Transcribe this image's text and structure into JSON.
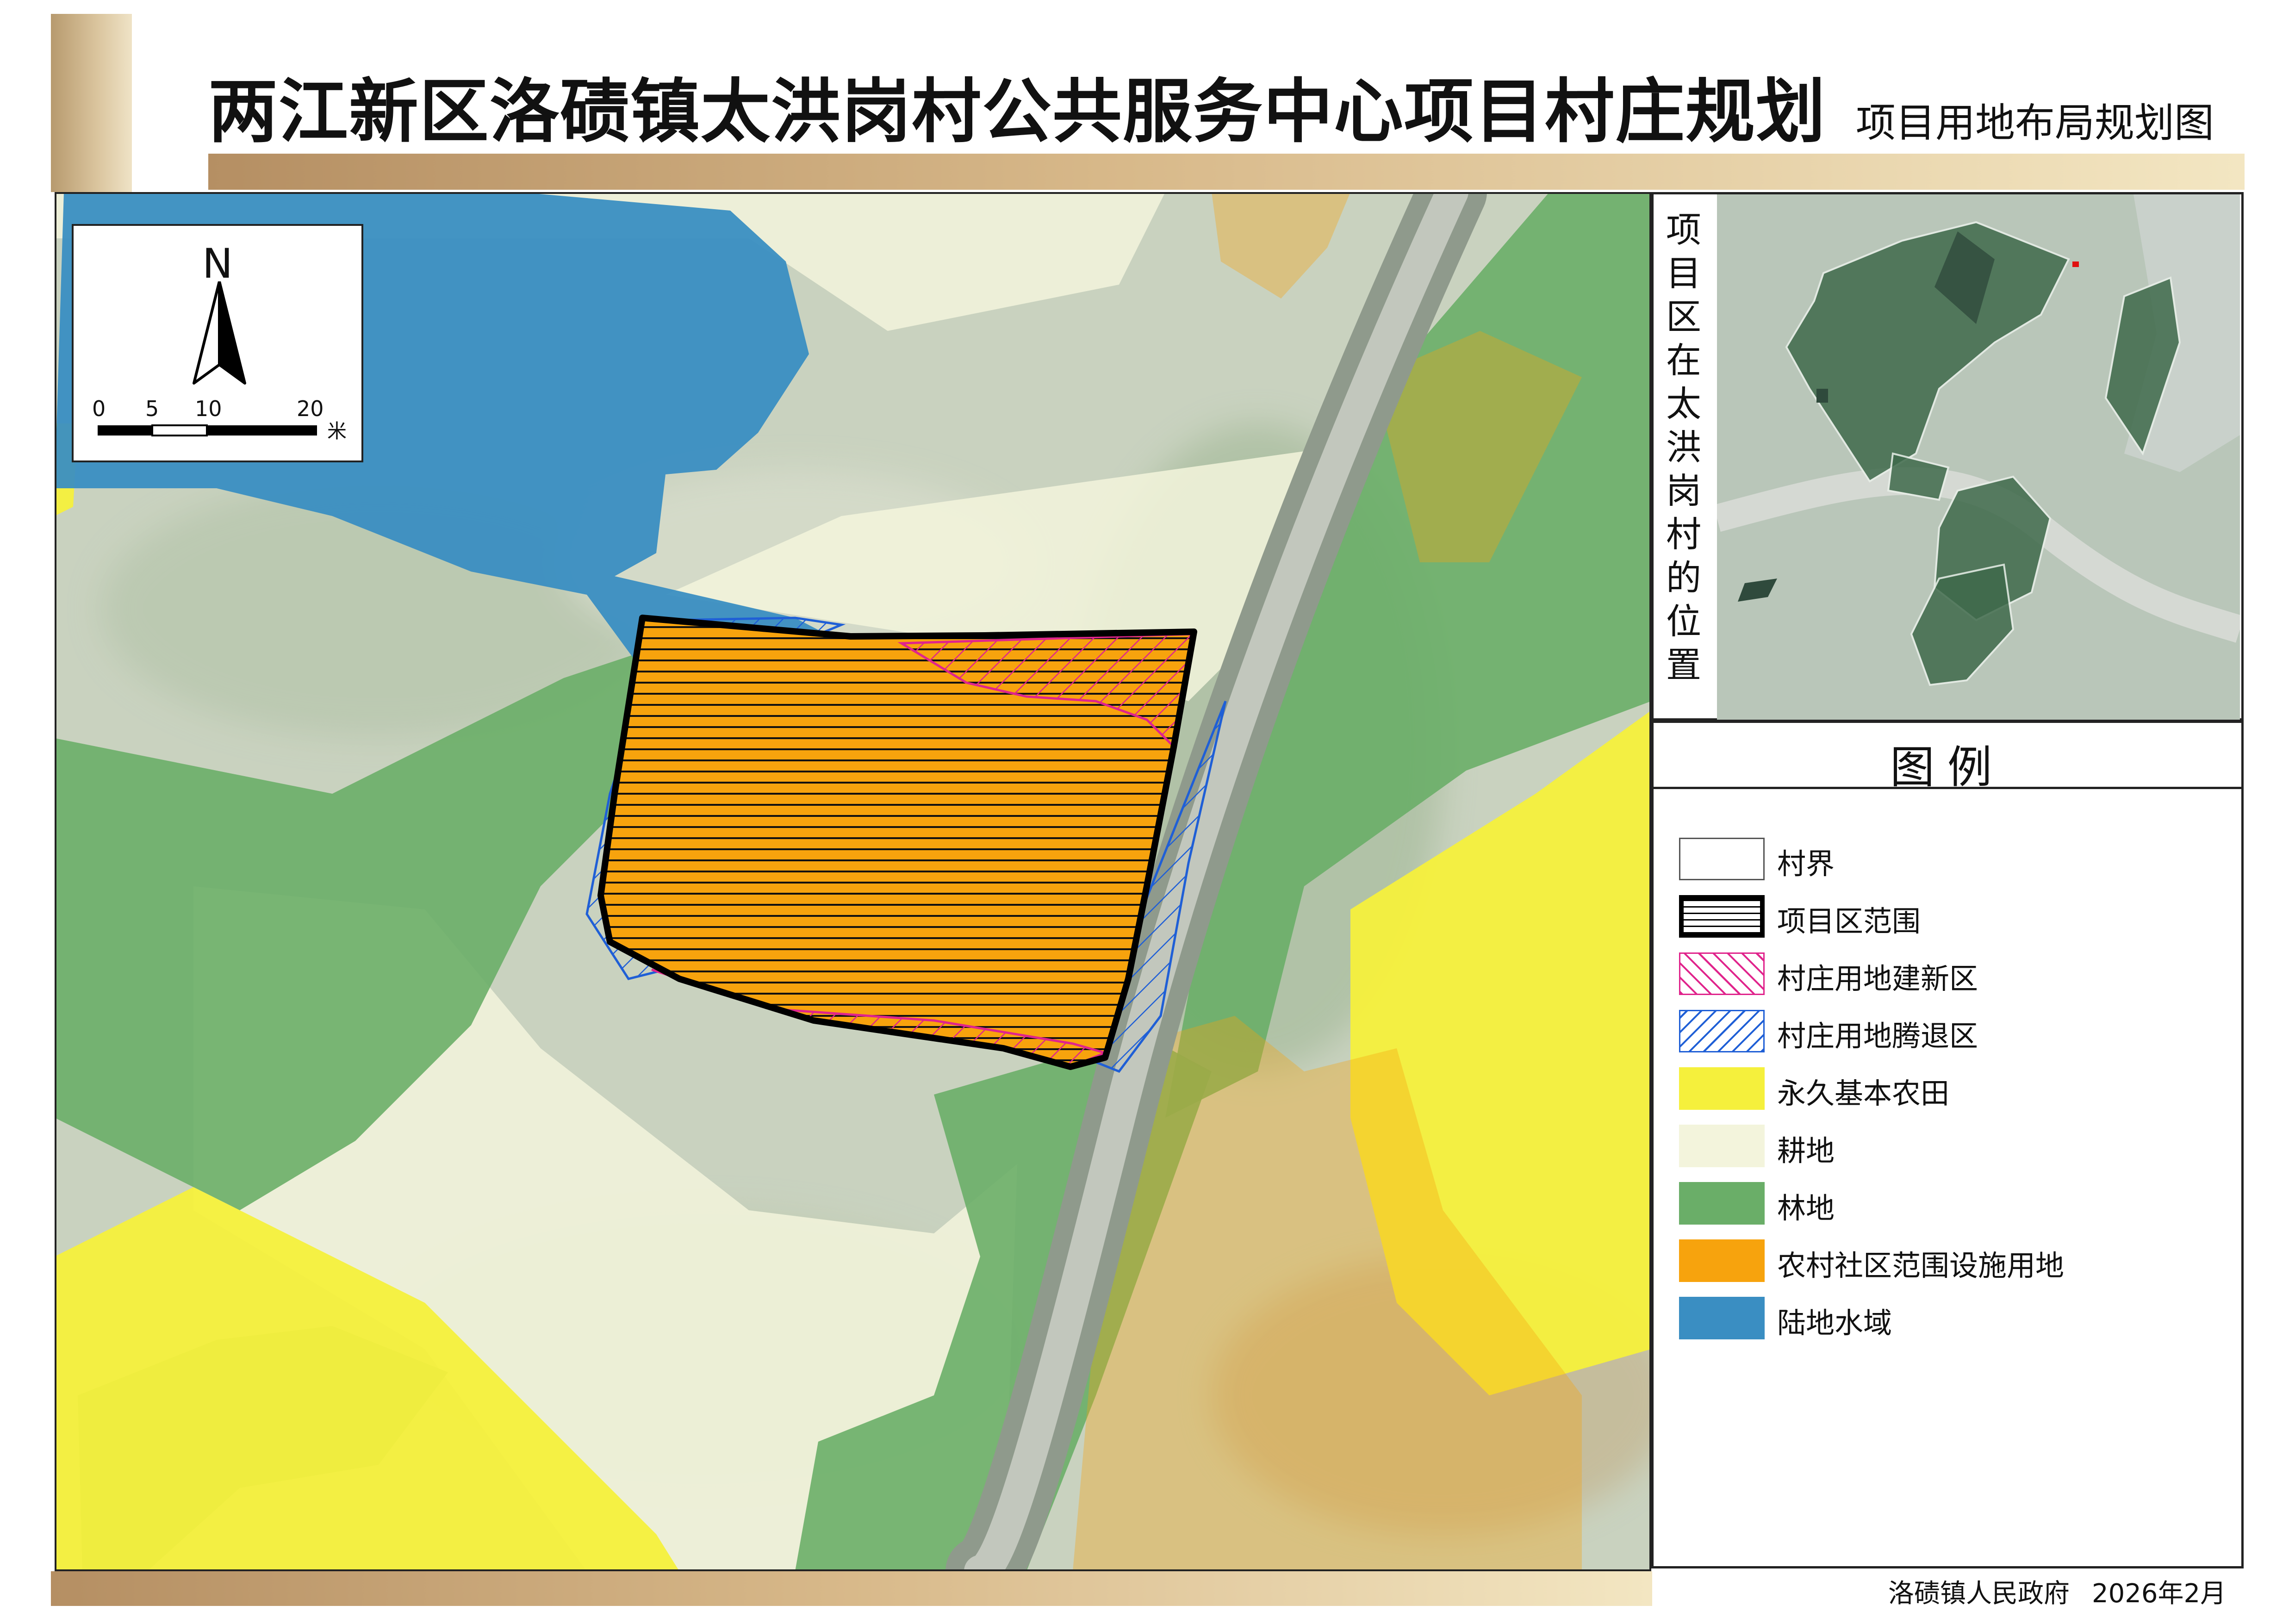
{
  "title": "两江新区洛碛镇太洪岗村公共服务中心项目村庄规划",
  "subtitle": "项目用地布局规划图",
  "compass": {
    "north": "N",
    "scale_ticks": [
      "0",
      "5",
      "10",
      "20"
    ],
    "scale_unit": "米"
  },
  "inset": {
    "caption": "项目区在太洪岗村的位置"
  },
  "legend": {
    "title": "图例",
    "items": [
      {
        "label": "村界",
        "color": "#ffffff",
        "pattern": "outline"
      },
      {
        "label": "项目区范围",
        "color": "#ffffff",
        "pattern": "horizontal-lines"
      },
      {
        "label": "村庄用地建新区",
        "color": "#e0248c",
        "pattern": "diagonal-hatch"
      },
      {
        "label": "村庄用地腾退区",
        "color": "#1f5fd6",
        "pattern": "diagonal-hatch"
      },
      {
        "label": "永久基本农田",
        "color": "#f5f03c",
        "pattern": "solid"
      },
      {
        "label": "耕地",
        "color": "#f3f4dc",
        "pattern": "solid"
      },
      {
        "label": "林地",
        "color": "#6aae68",
        "pattern": "solid"
      },
      {
        "label": "农村社区范围设施用地",
        "color": "#f7a30d",
        "pattern": "solid"
      },
      {
        "label": "陆地水域",
        "color": "#3a8ec2",
        "pattern": "solid"
      }
    ]
  },
  "footer": {
    "authority": "洛碛镇人民政府",
    "date": "2026年2月"
  }
}
